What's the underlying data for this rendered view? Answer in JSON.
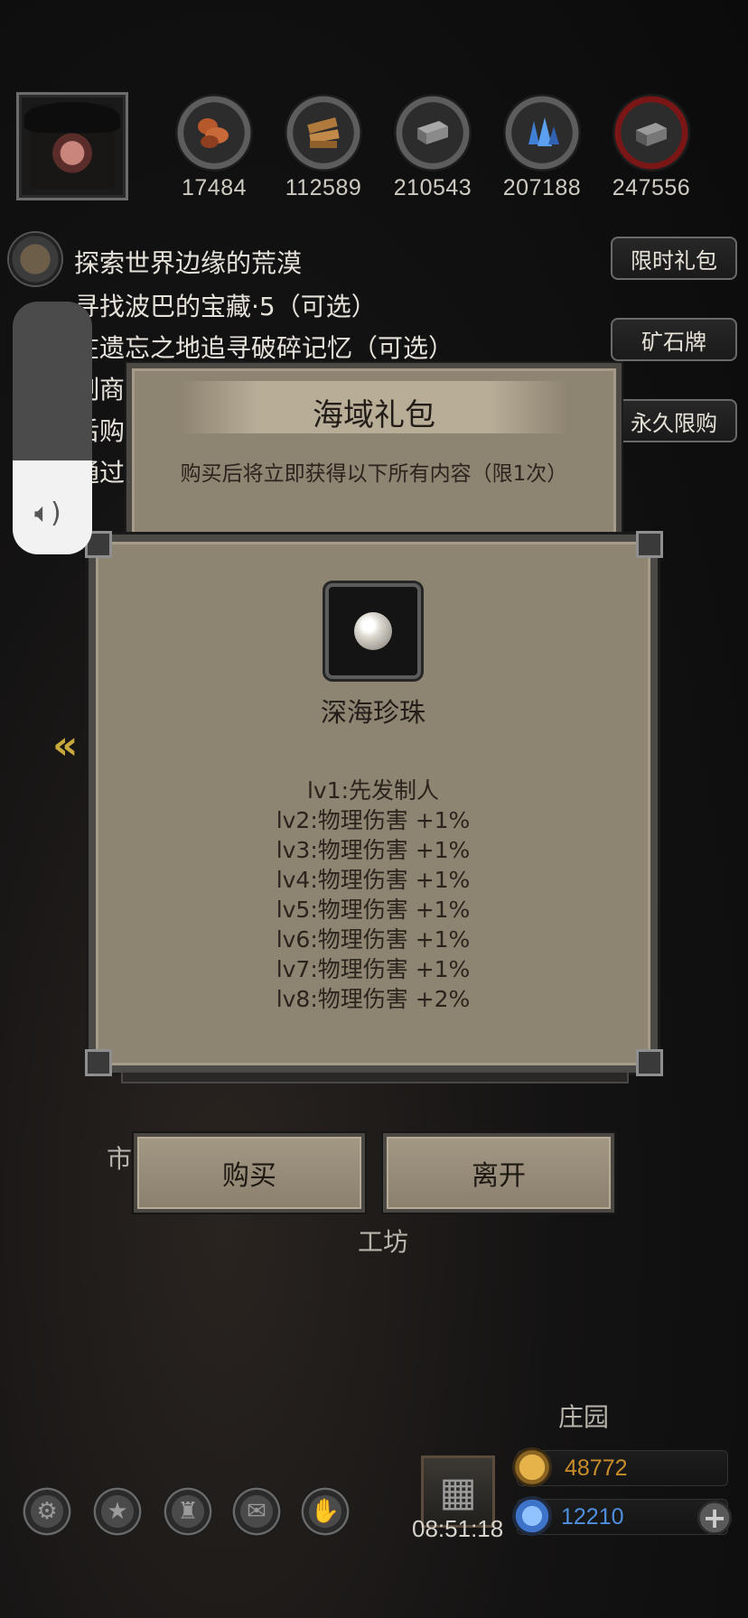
{
  "resources": [
    {
      "name": "leather-icon",
      "value": "17484",
      "color": "#b5582c"
    },
    {
      "name": "wood-icon",
      "value": "112589",
      "color": "#b07a3d"
    },
    {
      "name": "iron-icon",
      "value": "210543",
      "color": "#8d8d8d"
    },
    {
      "name": "crystal-icon",
      "value": "207188",
      "color": "#3f7fd6"
    },
    {
      "name": "ore-icon",
      "value": "247556",
      "color": "#7b7b7b"
    }
  ],
  "quests": [
    "探索世界边缘的荒漠",
    "寻找波巴的宝藏·5（可选）",
    "在遗忘之地追寻破碎记忆（可选）",
    "制商",
    "后购",
    "通过"
  ],
  "side_buttons": {
    "limited_gift": "限时礼包",
    "ore_card": "矿石牌",
    "permanent_limit": "永久限购"
  },
  "dialog": {
    "title": "海域礼包",
    "subtitle": "购买后将立即获得以下所有内容（限1次）",
    "item": {
      "icon": "pearl-icon",
      "name": "深海珍珠",
      "effects": [
        "lv1:先发制人",
        "lv2:物理伤害 +1%",
        "lv3:物理伤害 +1%",
        "lv4:物理伤害 +1%",
        "lv5:物理伤害 +1%",
        "lv6:物理伤害 +1%",
        "lv7:物理伤害 +1%",
        "lv8:物理伤害 +2%"
      ]
    },
    "buy_label": "购买",
    "leave_label": "离开"
  },
  "background_labels": {
    "market": "市",
    "workshop": "工坊",
    "manor": "庄园"
  },
  "bottom_bar": {
    "icons": [
      "settings-icon",
      "star-icon",
      "castle-icon",
      "mail-icon",
      "handshake-icon"
    ],
    "timer": "08:51:18",
    "gold": "48772",
    "gems": "12210",
    "gold_color": "#c98d2a",
    "gem_color": "#4f8fe0"
  },
  "volume_level": 0.37
}
